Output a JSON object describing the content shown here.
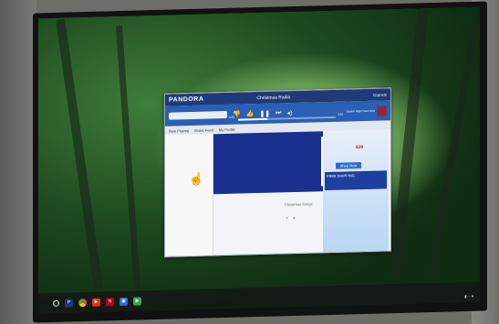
{
  "pandora": {
    "logo": "PANDORA",
    "station_title": "Christmas Radio",
    "user_area": "Upgrade",
    "search_placeholder": "",
    "time_elapsed": "0:38",
    "time_total": "3:59",
    "now_playing": "Station Right Here Now",
    "tabs": [
      "Now Playing",
      "Music Feed",
      "My Profile"
    ],
    "album_label": "Christmas Songs",
    "ad_price": "$29",
    "ad_button": "Shop Now",
    "ad_banner": "FREE SHIPPING"
  },
  "taskbar": {
    "apps": [
      {
        "name": "pandora",
        "glyph": "P",
        "color": "#1f3a78"
      },
      {
        "name": "chrome",
        "glyph": "",
        "color": "#e84a3b"
      },
      {
        "name": "youtube",
        "glyph": "▶",
        "color": "#e52d27"
      },
      {
        "name": "netflix",
        "glyph": "N",
        "color": "#b20710"
      },
      {
        "name": "files",
        "glyph": "▣",
        "color": "#2d6bd6"
      },
      {
        "name": "playstore",
        "glyph": "▶",
        "color": "#34a853"
      }
    ]
  }
}
